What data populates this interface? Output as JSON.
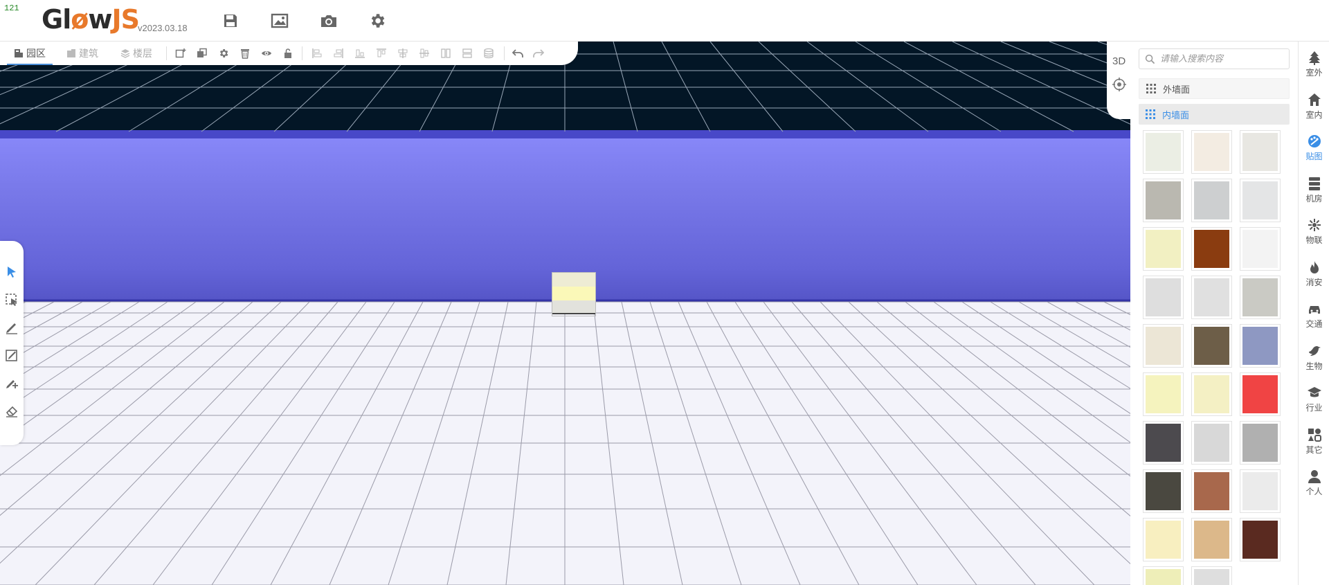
{
  "fps": "121",
  "brand": {
    "logo_main": "Gl",
    "logo_o": "ø",
    "logo_w": "w",
    "logo_js": "JS",
    "version": "v2023.03.18"
  },
  "header_icons": [
    "save-icon",
    "image-icon",
    "camera-icon",
    "settings-icon"
  ],
  "toolbar": {
    "tabs": [
      {
        "label": "园区",
        "icon": "campus-icon",
        "active": true
      },
      {
        "label": "建筑",
        "icon": "building-icon",
        "active": false
      },
      {
        "label": "楼层",
        "icon": "floor-layers-icon",
        "active": false
      }
    ],
    "tools": [
      "add-object-icon",
      "copy-icon",
      "gear-icon",
      "delete-icon",
      "visibility-icon",
      "unlock-icon"
    ],
    "align_tools": [
      "align-left-icon",
      "align-right-icon",
      "align-bottom-left-icon",
      "align-bottom-right-icon",
      "align-center-v-icon",
      "align-center-h-icon",
      "distribute-h-icon",
      "distribute-v-icon",
      "layers-icon"
    ],
    "history": [
      "undo-icon",
      "redo-icon"
    ]
  },
  "view": {
    "mode_label": "3D",
    "compass_icon": "compass-icon"
  },
  "left_tools": [
    "select-pointer-icon",
    "box-select-icon",
    "draw-line-icon",
    "draw-area-icon",
    "add-point-icon",
    "eraser-icon"
  ],
  "panel": {
    "search_placeholder": "请输入搜索内容",
    "categories": [
      {
        "label": "外墙面",
        "active": false
      },
      {
        "label": "内墙面",
        "active": true
      }
    ],
    "swatch_colors": [
      "#ebeee4",
      "#f3ece2",
      "#e8e7e2",
      "#bab8b0",
      "#cdcfd0",
      "#e4e5e6",
      "#f2f0c2",
      "#8a3c10",
      "#f3f3f3",
      "#dedede",
      "#e0e0e0",
      "#cacac4",
      "#ece6d6",
      "#6d5e48",
      "#8e98c2",
      "#f5f3be",
      "#f4f0c4",
      "#f04444",
      "#4c4a4e",
      "#d8d8d8",
      "#b0b0b0",
      "#4a4840",
      "#a8684c",
      "#ebebeb",
      "#f8efc0",
      "#dcb88a",
      "#5a2a20",
      "#eeeeb8",
      "#dedede"
    ]
  },
  "rail": [
    {
      "label": "室外",
      "icon": "tree-icon",
      "active": false
    },
    {
      "label": "室内",
      "icon": "home-icon",
      "active": false
    },
    {
      "label": "贴图",
      "icon": "palette-icon",
      "active": true
    },
    {
      "label": "机房",
      "icon": "server-icon",
      "active": false
    },
    {
      "label": "物联",
      "icon": "iot-network-icon",
      "active": false
    },
    {
      "label": "消安",
      "icon": "fire-icon",
      "active": false
    },
    {
      "label": "交通",
      "icon": "car-icon",
      "active": false
    },
    {
      "label": "生物",
      "icon": "bird-icon",
      "active": false
    },
    {
      "label": "行业",
      "icon": "graduation-cap-icon",
      "active": false
    },
    {
      "label": "其它",
      "icon": "shapes-icon",
      "active": false
    },
    {
      "label": "个人",
      "icon": "user-icon",
      "active": false
    }
  ],
  "colors": {
    "accent": "#3a8ee6",
    "logo_orange": "#e8792b",
    "sky": "#031626",
    "wall": "#7a7aea",
    "floor": "#f3f3fa"
  }
}
